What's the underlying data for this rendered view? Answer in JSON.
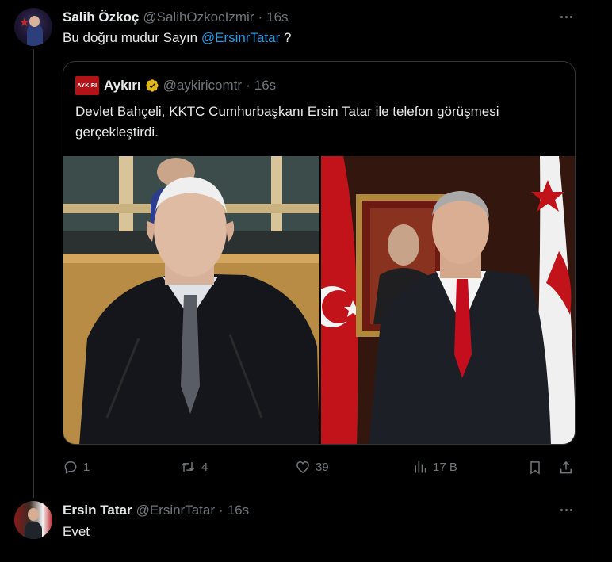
{
  "tweet1": {
    "name": "Salih Özkoç",
    "handle": "@SalihOzkocIzmir",
    "separator": "·",
    "time": "16s",
    "text_before": "Bu doğru mudur Sayın ",
    "mention": "@ErsinrTatar",
    "text_after": " ?",
    "quote": {
      "logo_text": "AYKIRI",
      "name": "Aykırı",
      "handle": "@aykiricomtr",
      "separator": "·",
      "time": "16s",
      "text": "Devlet Bahçeli, KKTC Cumhurbaşkanı Ersin Tatar ile telefon görüşmesi gerçekleştirdi."
    },
    "actions": {
      "replies": "1",
      "reposts": "4",
      "likes": "39",
      "views": "17 B"
    }
  },
  "tweet2": {
    "name": "Ersin Tatar",
    "handle": "@ErsinrTatar",
    "separator": "·",
    "time": "16s",
    "text": "Evet"
  },
  "colors": {
    "background": "#000000",
    "text": "#e7e9ea",
    "muted": "#71767b",
    "accent": "#1d9bf0",
    "border": "#2f3336",
    "verified_gold": "#e2b719"
  },
  "icons": [
    "more-icon",
    "verified-gold-icon",
    "reply-icon",
    "repost-icon",
    "like-icon",
    "views-icon",
    "bookmark-icon",
    "share-icon"
  ]
}
